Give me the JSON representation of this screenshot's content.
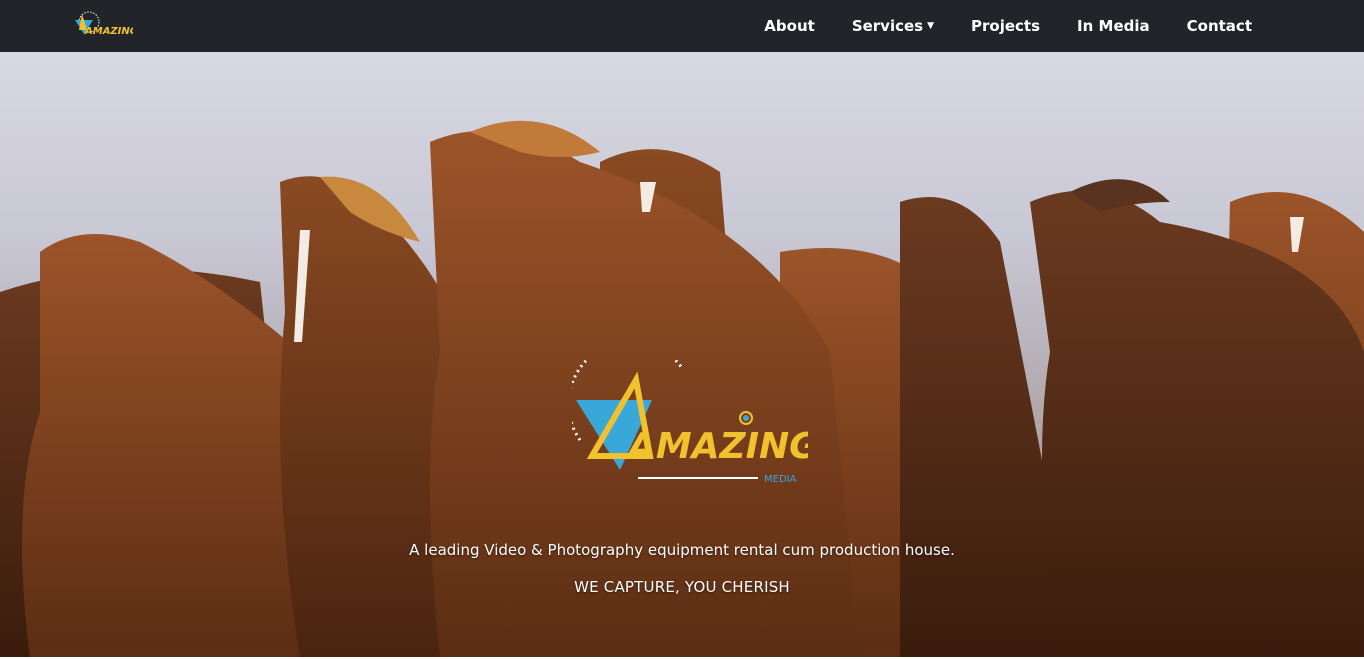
{
  "header": {
    "logo_icon": "amazing-media-logo",
    "nav": {
      "about": "About",
      "services": "Services",
      "projects": "Projects",
      "in_media": "In Media",
      "contact": "Contact"
    }
  },
  "hero": {
    "background": "horses-herd-image",
    "logo": {
      "wordmark": "AMAZING",
      "subtext": "MEDIA"
    },
    "tagline": "A leading Video & Photography equipment rental cum production house.",
    "motto": "WE CAPTURE, YOU CHERISH"
  },
  "colors": {
    "nav_bg": "#212529",
    "logo_yellow": "#f2c12e",
    "logo_blue": "#3aa7d9"
  }
}
